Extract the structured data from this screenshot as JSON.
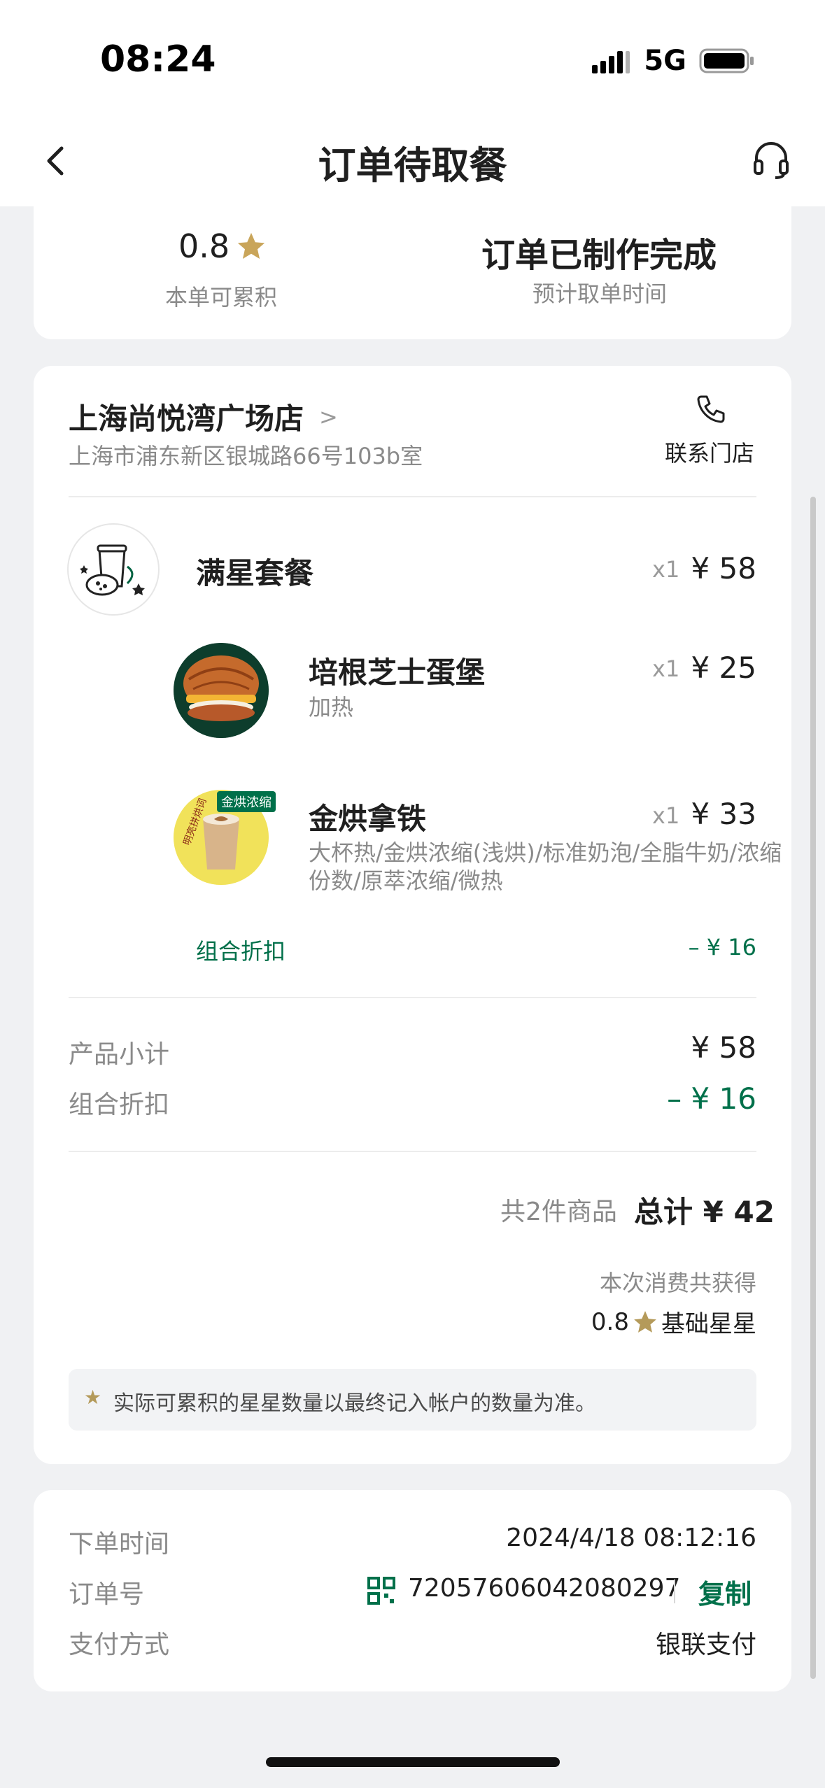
{
  "status_bar": {
    "time": "08:24",
    "network": "5G"
  },
  "nav": {
    "title": "订单待取餐",
    "back_icon": "chevron-left-icon",
    "service_icon": "headset-icon"
  },
  "summary": {
    "stars_value": "0.8",
    "stars_label": "本单可累积",
    "order_status": "订单已制作完成",
    "pickup_label": "预计取单时间"
  },
  "store": {
    "name": "上海尚悦湾广场店",
    "chevron": ">",
    "address": "上海市浦东新区银城路66号103b室",
    "contact_label": "联系门店"
  },
  "items": {
    "combo": {
      "name": "满星套餐",
      "qty": "x1",
      "price": "¥ 58"
    },
    "sub1": {
      "name": "培根芝士蛋堡",
      "desc": "加热",
      "qty": "x1",
      "price": "¥ 25"
    },
    "sub2": {
      "name": "金烘拿铁",
      "badge": "金烘浓缩",
      "desc": "大杯热/金烘浓缩(浅烘)/标准奶泡/全脂牛奶/浓缩份数/原萃浓缩/微热",
      "qty": "x1",
      "price": "¥ 33"
    },
    "combo_discount_label": "组合折扣",
    "combo_discount_value": "– ¥ 16"
  },
  "totals": {
    "subtotal_label": "产品小计",
    "subtotal_value": "¥ 58",
    "discount_label": "组合折扣",
    "discount_value": "– ¥ 16",
    "count_text": "共2件商品",
    "total_text": "总计 ¥ 42",
    "earn_label": "本次消费共获得",
    "earn_value": "0.8",
    "earn_unit": "基础星星",
    "note": "实际可累积的星星数量以最终记入帐户的数量为准。"
  },
  "info": {
    "order_time_label": "下单时间",
    "order_time_value": "2024/4/18 08:12:16",
    "order_no_label": "订单号",
    "order_no_value": "72057606042080297",
    "copy_label": "复制",
    "pay_label": "支付方式",
    "pay_value": "银联支付"
  },
  "colors": {
    "brand_green": "#00704a",
    "star_gold": "#b49a5a"
  }
}
